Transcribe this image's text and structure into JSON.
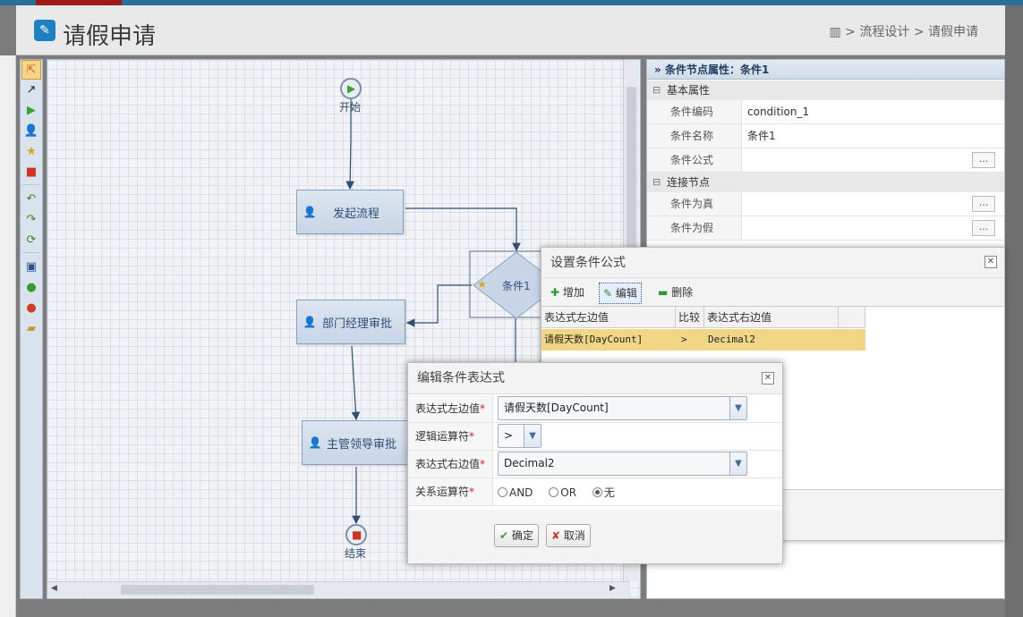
{
  "header": {
    "title": "请假申请",
    "breadcrumb": [
      "流程设计",
      "请假申请"
    ],
    "sep": ">"
  },
  "toolbar": {
    "tools": [
      "select-icon",
      "transition-icon",
      "start-icon",
      "task-icon",
      "condition-icon",
      "end-icon",
      "undo-icon",
      "redo-icon",
      "refresh-icon",
      "save-icon",
      "info-icon",
      "warning-icon",
      "folder-icon"
    ]
  },
  "flow": {
    "nodes": {
      "start": "开始",
      "launch": "发起流程",
      "condition": "条件1",
      "dept": "部门经理审批",
      "leader": "主管领导审批",
      "end": "结束"
    }
  },
  "props": {
    "header": "条件节点属性：条件1",
    "group_basic": "基本属性",
    "code_label": "条件编码",
    "code_value": "condition_1",
    "name_label": "条件名称",
    "name_value": "条件1",
    "formula_label": "条件公式",
    "group_conn": "连接节点",
    "true_label": "条件为真",
    "false_label": "条件为假",
    "dots": "..."
  },
  "formula_dialog": {
    "title": "设置条件公式",
    "add": "增加",
    "edit": "编辑",
    "delete": "删除",
    "columns": [
      "表达式左边值",
      "比较",
      "表达式右边值"
    ],
    "rows": [
      {
        "left": "请假天数[DayCount]",
        "op": ">",
        "right": "Decimal2"
      }
    ]
  },
  "edit_dialog": {
    "title": "编辑条件表达式",
    "left_label": "表达式左边值",
    "left_value": "请假天数[DayCount]",
    "op_label": "逻辑运算符",
    "op_value": ">",
    "right_label": "表达式右边值",
    "right_value": "Decimal2",
    "rel_label": "关系运算符",
    "rel_options": [
      "AND",
      "OR",
      "无"
    ],
    "rel_selected": "无",
    "req": "*",
    "ok": "确定",
    "cancel": "取消"
  },
  "colors": {
    "accent": "#2a6f9a",
    "node_text": "#2f4f73",
    "selected_row": "#f0d685"
  }
}
